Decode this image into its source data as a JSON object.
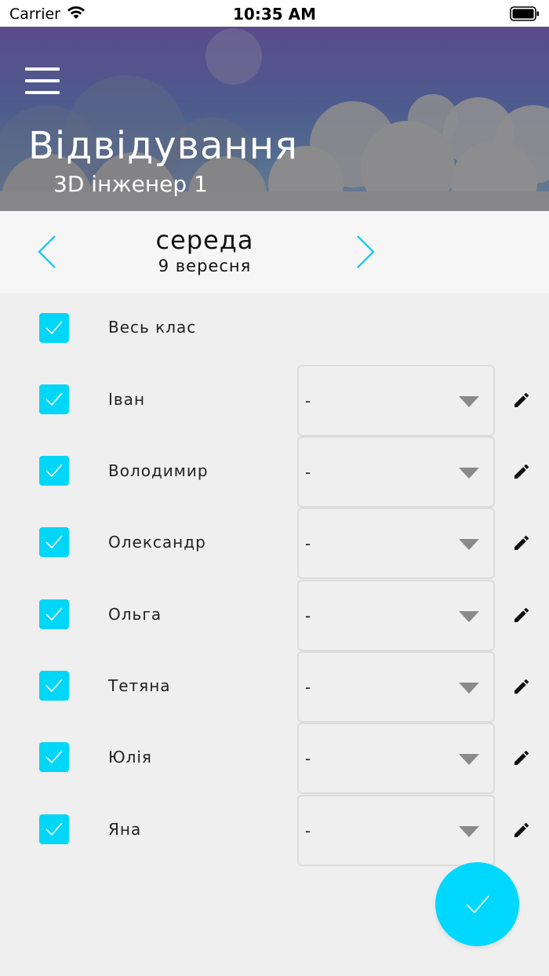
{
  "status_bar": {
    "carrier": "Carrier",
    "time": "10:35 AM"
  },
  "header": {
    "title": "Відвідування",
    "subtitle": "3D інженер 1"
  },
  "date_nav": {
    "weekday": "середа",
    "date": "9 вересня"
  },
  "whole_class": {
    "label": "Весь клас",
    "checked": true
  },
  "students": [
    {
      "name": " Іван",
      "checked": true,
      "status": "-"
    },
    {
      "name": "Володимир",
      "checked": true,
      "status": "-"
    },
    {
      "name": "Олександр",
      "checked": true,
      "status": "-"
    },
    {
      "name": "Ольга",
      "checked": true,
      "status": "-"
    },
    {
      "name": "Тетяна",
      "checked": true,
      "status": "-"
    },
    {
      "name": "Юлія",
      "checked": true,
      "status": "-"
    },
    {
      "name": "Яна",
      "checked": true,
      "status": "-"
    }
  ],
  "colors": {
    "accent": "#00d6f7",
    "header_top": "#5a4c8c",
    "header_bottom": "#6f7f92"
  },
  "icons": [
    "wifi-icon",
    "battery-icon",
    "menu-icon",
    "chevron-left-icon",
    "chevron-right-icon",
    "check-icon",
    "caret-down-icon",
    "pencil-icon"
  ]
}
